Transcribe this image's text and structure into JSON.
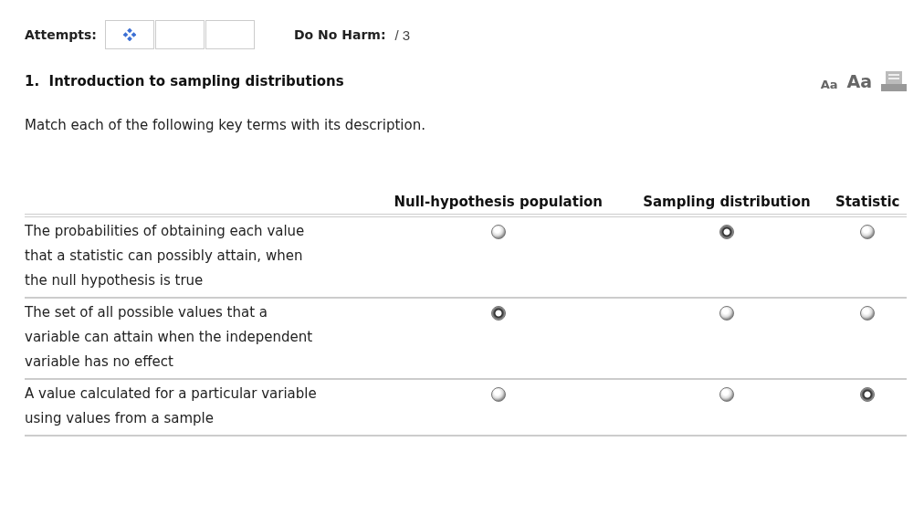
{
  "attempts": {
    "label": "Attempts:",
    "boxes": [
      {
        "current": true
      },
      {
        "current": false
      },
      {
        "current": false
      }
    ]
  },
  "do_no_harm": {
    "label": "Do No Harm:",
    "score": "/ 3"
  },
  "question": {
    "title": "1.  Introduction to sampling distributions",
    "prompt": "Match each of the following key terms with its description."
  },
  "font_controls": [
    "Aa",
    "Aa"
  ],
  "table": {
    "columns": [
      "Null-hypothesis population",
      "Sampling distribution",
      "Statistic"
    ],
    "rows": [
      {
        "description": "The probabilities of obtaining each value that a statistic can possibly attain, when the null hypothesis is true",
        "choices": [
          {
            "selected": false
          },
          {
            "selected": true
          },
          {
            "selected": false
          }
        ]
      },
      {
        "description": "The set of all possible values that a variable can attain when the independent variable has no effect",
        "choices": [
          {
            "selected": true
          },
          {
            "selected": false
          },
          {
            "selected": false
          }
        ]
      },
      {
        "description": "A value calculated for a particular variable using values from a sample",
        "choices": [
          {
            "selected": false
          },
          {
            "selected": false
          },
          {
            "selected": true
          }
        ]
      }
    ]
  }
}
